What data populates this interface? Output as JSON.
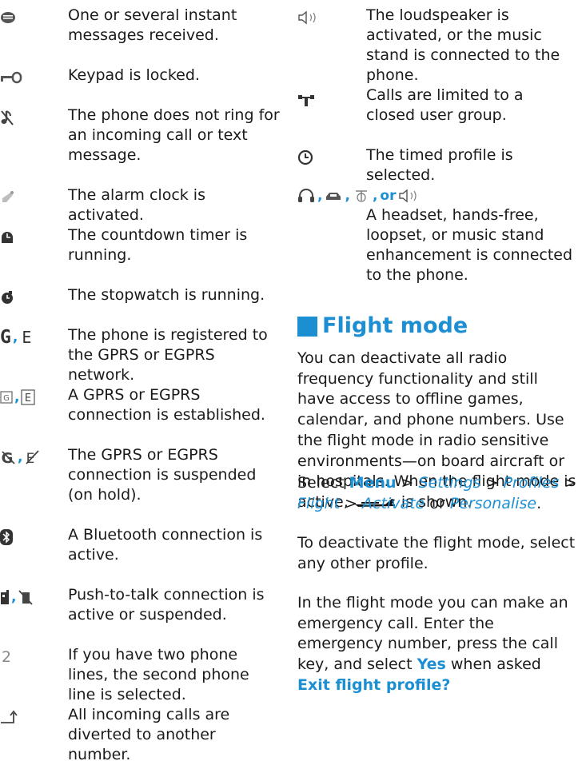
{
  "left_column": [
    {
      "icon": "instant-message-icon",
      "text": "One or several instant messages received."
    },
    {
      "icon": "key-locked-icon",
      "text": "Keypad is locked."
    },
    {
      "icon": "silent-note-icon",
      "text": "The phone does not ring for an incoming call or text message."
    },
    {
      "icon": "alarm-bell-icon",
      "text": "The alarm clock is activated."
    },
    {
      "icon": "countdown-timer-icon",
      "text": "The countdown timer is running."
    },
    {
      "icon": "stopwatch-icon",
      "text": "The stopwatch is running."
    },
    {
      "icons": [
        "G",
        "E"
      ],
      "text": "The phone is registered to the GPRS or EGPRS network."
    },
    {
      "icons": [
        "boxed-g-icon",
        "boxed-e-icon"
      ],
      "text": "A GPRS or EGPRS connection is established."
    },
    {
      "icons": [
        "suspended-g-icon",
        "suspended-e-icon"
      ],
      "text": "The GPRS or EGPRS connection is suspended (on hold)."
    },
    {
      "icon": "bluetooth-icon",
      "text": "A Bluetooth connection is active."
    },
    {
      "icons": [
        "ptt-active-icon",
        "ptt-suspended-icon"
      ],
      "text": "Push-to-talk connection is active or suspended."
    },
    {
      "icon": "line-2-icon",
      "glyph": "2",
      "text": "If you have two phone lines, the second phone line is selected."
    },
    {
      "icon": "divert-arrow-icon",
      "text": "All incoming calls are diverted to another number."
    }
  ],
  "right_column": [
    {
      "icon": "loudspeaker-icon",
      "text": "The loudspeaker is activated, or the music stand is connected to the phone."
    },
    {
      "icon": "closed-group-icon",
      "text": "Calls are limited to a closed user group."
    },
    {
      "icon": "timed-profile-icon",
      "text": "The timed profile is selected."
    }
  ],
  "enhancement": {
    "separator": ",",
    "or_label": "or",
    "text": "A headset, hands-free, loopset, or music stand enhancement is connected to the phone."
  },
  "section": {
    "heading": "Flight mode",
    "p1_a": "You can deactivate all radio frequency functionality and still have access to offline games, calendar, and phone numbers. Use the flight mode in radio sensitive environments—on board aircraft or in hospitals. When the flight mode is active, ",
    "p1_b": " is shown.",
    "p2_select": "Select ",
    "p2_menu": "Menu",
    "gt": " > ",
    "p2_settings": "Settings",
    "p2_profiles": "Profiles",
    "p2_flight": "Flight",
    "p2_activate": "Activate",
    "p2_or": " or ",
    "p2_personalise": "Personalise",
    "p2_end": ".",
    "p3": "To deactivate the flight mode, select any other profile.",
    "p4_a": "In the flight mode you can make an emergency call. Enter the emergency number, press the call key, and select ",
    "p4_yes": "Yes",
    "p4_b": " when asked ",
    "p4_exit": "Exit flight profile?"
  }
}
